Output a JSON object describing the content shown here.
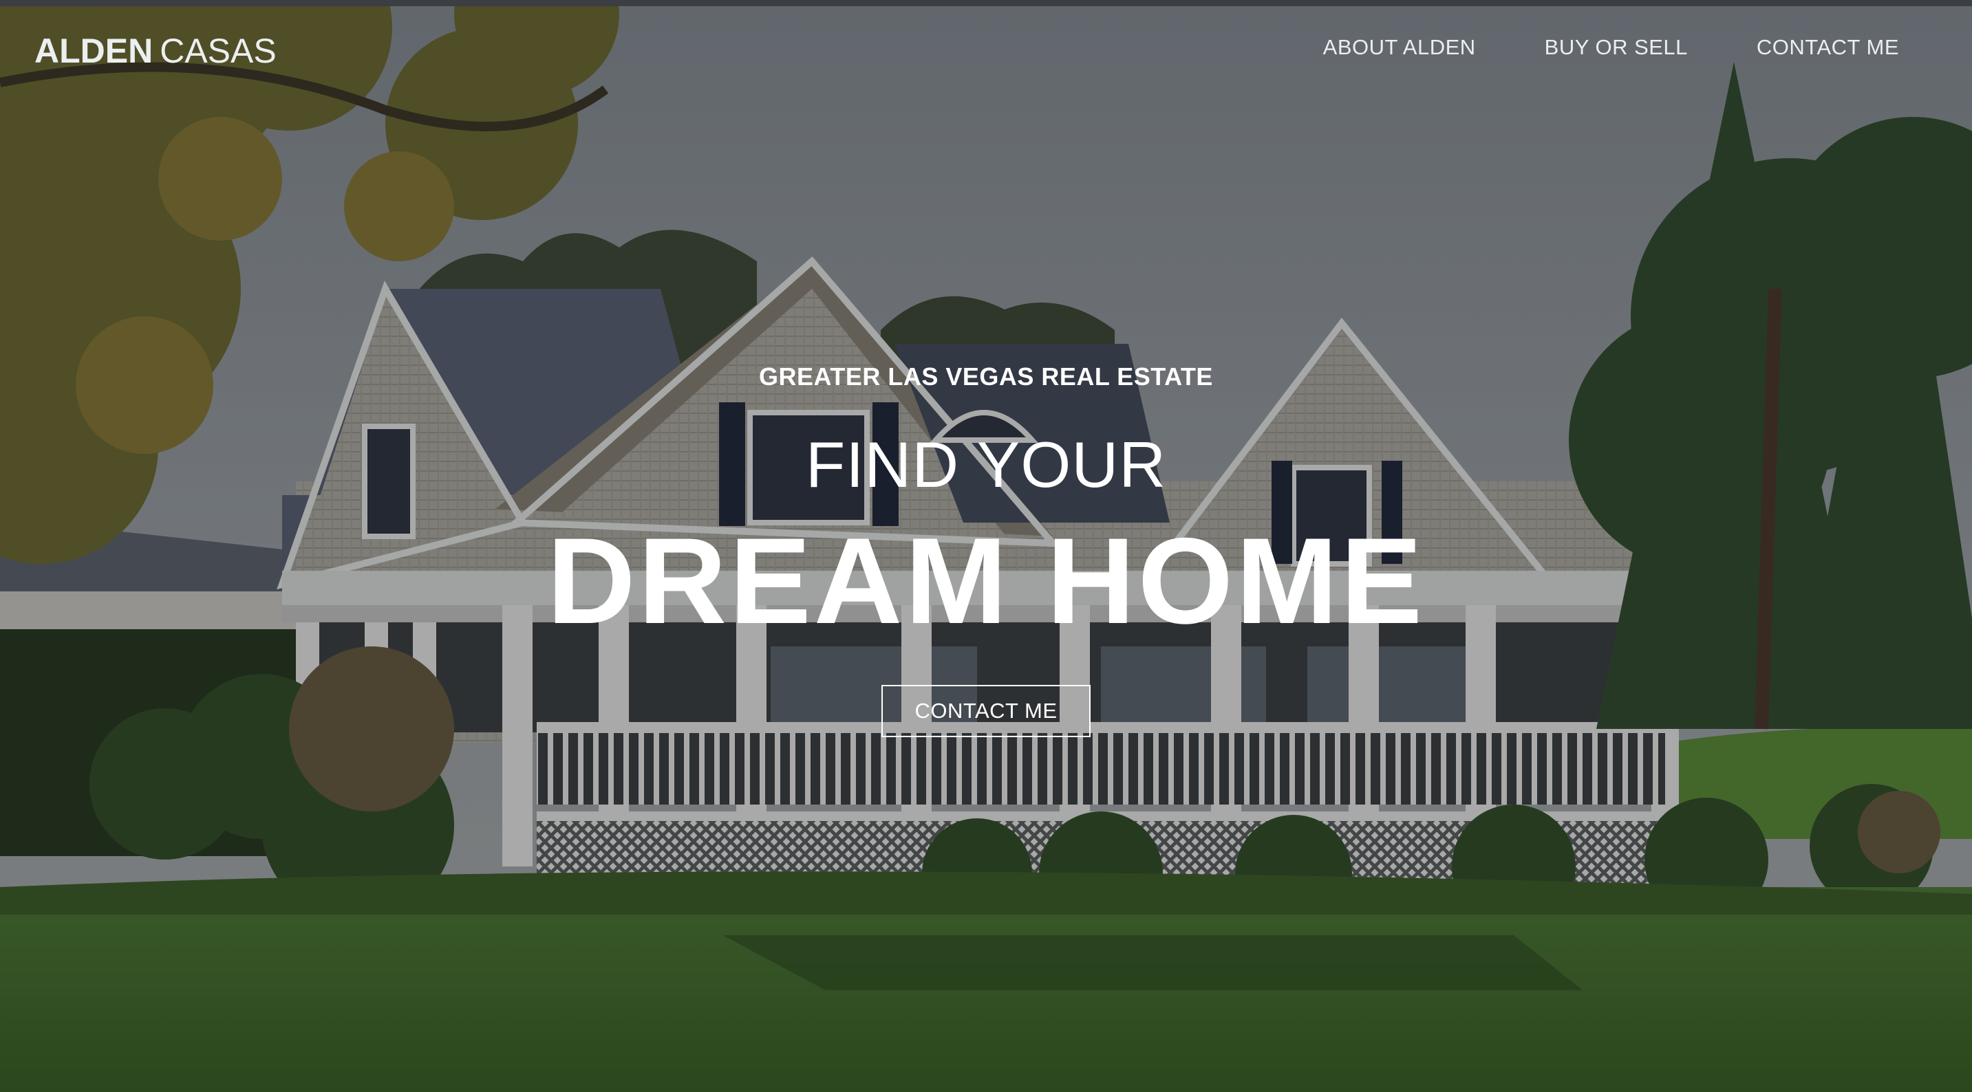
{
  "brand": {
    "bold": "ALDEN",
    "light": "CASAS"
  },
  "nav": {
    "items": [
      {
        "label": "ABOUT ALDEN"
      },
      {
        "label": "BUY OR SELL"
      },
      {
        "label": "CONTACT ME"
      }
    ]
  },
  "hero": {
    "eyebrow": "GREATER LAS VEGAS REAL ESTATE",
    "headline_light": "FIND YOUR",
    "headline_bold": "DREAM HOME",
    "cta_label": "CONTACT ME",
    "background": "house-photo"
  },
  "colors": {
    "text": "#ffffff",
    "nav_text": "#eceff1",
    "overlay": "rgba(20,22,26,0.34)"
  }
}
